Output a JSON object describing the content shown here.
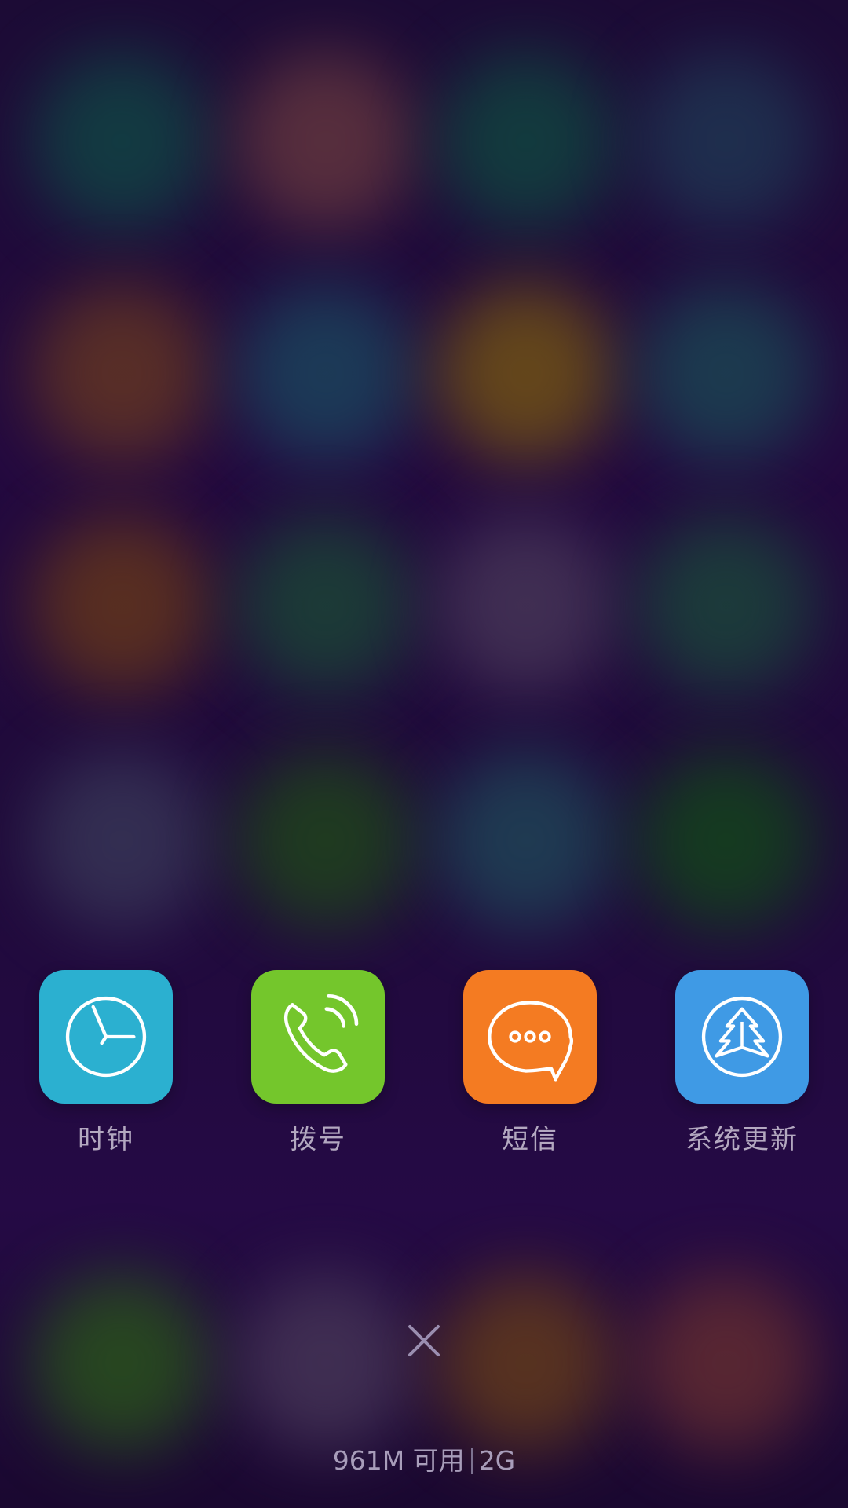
{
  "background": {
    "colors": [
      "#0f4a45",
      "#6a3a3f",
      "#0f4a40",
      "#1f3a55",
      "#6a3a20",
      "#1a4a60",
      "#7a5a10",
      "#1a4a55",
      "#6a3a18",
      "#1a4a35",
      "#4a3a5a",
      "#1a4a3a",
      "#3a3a5a",
      "#1f4a18",
      "#1f4a5a",
      "#124a18",
      "#2a5a18",
      "#4a3a5a",
      "#6a4018",
      "#6a3030"
    ]
  },
  "recent_apps": [
    {
      "label": "时钟",
      "icon": "clock-icon",
      "color": "#2bb0d0"
    },
    {
      "label": "拨号",
      "icon": "phone-icon",
      "color": "#74c62c"
    },
    {
      "label": "短信",
      "icon": "message-icon",
      "color": "#f47b22"
    },
    {
      "label": "系统更新",
      "icon": "update-icon",
      "color": "#3f9ae5"
    }
  ],
  "close": {
    "icon": "close-icon"
  },
  "memory": {
    "available": "961M 可用",
    "total": "2G"
  }
}
